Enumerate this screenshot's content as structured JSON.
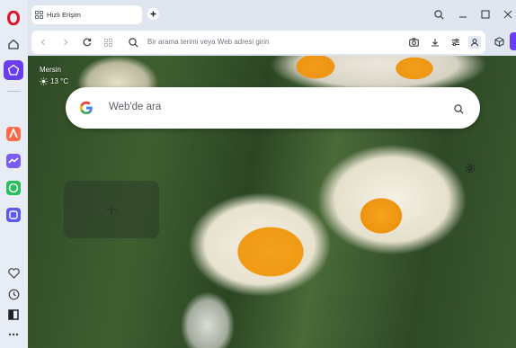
{
  "tab": {
    "title": "Hızlı Erişim"
  },
  "address_bar": {
    "placeholder": "Bir arama terimi veya Web adresi girin"
  },
  "weather": {
    "city": "Mersin",
    "temperature": "13 °C"
  },
  "search": {
    "placeholder": "Web'de ara",
    "engine": "Google"
  },
  "sidebar": {
    "top_items": [
      "opera-logo-icon",
      "home-icon",
      "pinboard-icon"
    ],
    "apps": [
      "aria-icon",
      "messenger-icon",
      "whatsapp-icon",
      "instagram-icon"
    ],
    "bottom_items": [
      "heart-icon",
      "clock-icon",
      "sidebar-toggle-icon",
      "more-icon"
    ]
  },
  "colors": {
    "opera_red": "#e1132b",
    "accent_purple": "#6a3df0",
    "sidebar_bg": "#e8edf5"
  }
}
